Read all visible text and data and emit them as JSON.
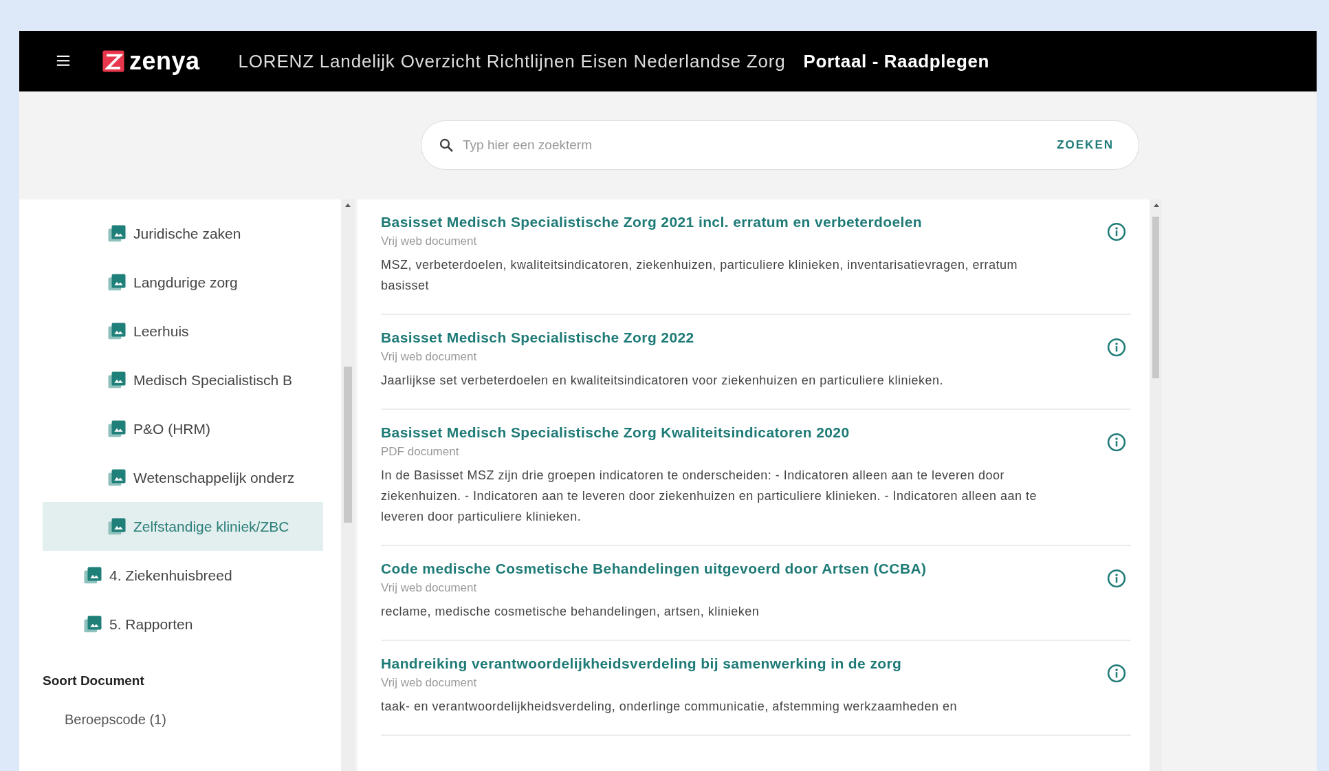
{
  "header": {
    "logo": "zenya",
    "title": "LORENZ Landelijk Overzicht Richtlijnen Eisen Nederlandse Zorg",
    "subtitle": "Portaal - Raadplegen"
  },
  "search": {
    "placeholder": "Typ hier een zoekterm",
    "button": "ZOEKEN"
  },
  "sidebar": {
    "tree": [
      {
        "children": [
          {
            "label": "Juridische zaken",
            "selected": false
          },
          {
            "label": "Langdurige zorg",
            "selected": false
          },
          {
            "label": "Leerhuis",
            "selected": false
          },
          {
            "label": "Medisch Specialistisch B",
            "selected": false
          },
          {
            "label": "P&O (HRM)",
            "selected": false
          },
          {
            "label": "Wetenschappelijk onderz",
            "selected": false
          },
          {
            "label": "Zelfstandige kliniek/ZBC",
            "selected": true
          }
        ]
      },
      {
        "label": "4. Ziekenhuisbreed",
        "selected": false
      },
      {
        "label": "5. Rapporten",
        "selected": false
      }
    ],
    "sections": [
      {
        "heading": "Soort Document",
        "items": [
          "Beroepscode (1)"
        ]
      }
    ]
  },
  "results": [
    {
      "title": "Basisset Medisch Specialistische Zorg 2021 incl. erratum en verbeterdoelen",
      "type": "Vrij web document",
      "description": "MSZ, verbeterdoelen, kwaliteitsindicatoren, ziekenhuizen, particuliere klinieken, inventarisatievragen, erratum basisset"
    },
    {
      "title": "Basisset Medisch Specialistische Zorg 2022",
      "type": "Vrij web document",
      "description": "Jaarlijkse set verbeterdoelen en kwaliteitsindicatoren voor ziekenhuizen en particuliere klinieken."
    },
    {
      "title": "Basisset Medisch Specialistische Zorg Kwaliteitsindicatoren 2020",
      "type": "PDF document",
      "description": "In de Basisset MSZ zijn drie groepen indicatoren te onderscheiden: - Indicatoren alleen aan te leveren door ziekenhuizen. - Indicatoren aan te leveren door ziekenhuizen en particuliere klinieken. - Indicatoren alleen aan te leveren door particuliere klinieken."
    },
    {
      "title": "Code medische Cosmetische Behandelingen uitgevoerd door Artsen (CCBA)",
      "type": "Vrij web document",
      "description": "reclame, medische cosmetische behandelingen, artsen, klinieken"
    },
    {
      "title": "Handreiking verantwoordelijkheidsverdeling bij samenwerking in de zorg",
      "type": "Vrij web document",
      "description": "taak- en verantwoordelijkheidsverdeling, onderlinge communicatie, afstemming werkzaamheden en"
    }
  ]
}
